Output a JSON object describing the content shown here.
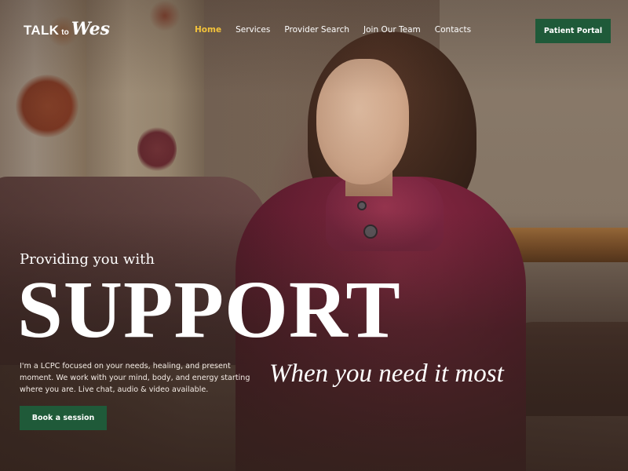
{
  "logo": {
    "word1": "TALK",
    "word2": "to",
    "word3": "Wes"
  },
  "nav": {
    "items": [
      {
        "label": "Home",
        "active": true
      },
      {
        "label": "Services",
        "active": false
      },
      {
        "label": "Provider Search",
        "active": false
      },
      {
        "label": "Join Our Team",
        "active": false
      },
      {
        "label": "Contacts",
        "active": false
      }
    ],
    "portal_label": "Patient Portal"
  },
  "hero": {
    "kicker": "Providing you with",
    "headline": "SUPPORT",
    "tagline": "When you need it most",
    "description": "I'm a LCPC focused on your needs, healing, and present moment. We work with your mind, body, and energy starting where you are. Live chat, audio & video available.",
    "cta_label": "Book a session"
  },
  "colors": {
    "accent_green": "#1f5a39",
    "active_nav": "#f2c23b",
    "text": "#ffffff"
  }
}
